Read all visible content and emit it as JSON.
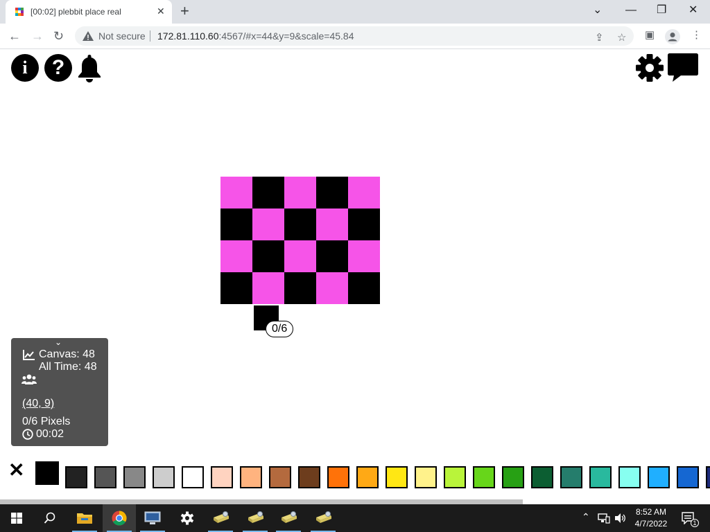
{
  "browser": {
    "tab_title": "[00:02] plebbit place real",
    "tab_close": "✕",
    "new_tab": "+",
    "window_controls": {
      "minimize": "—",
      "maximize": "❐",
      "close": "✕"
    },
    "nav": {
      "back": "←",
      "forward": "→",
      "reload": "↻"
    },
    "security_label": "Not secure",
    "url_host": "172.81.110.60",
    "url_rest": ":4567/#x=44&y=9&scale=45.84",
    "icons": [
      "share-icon",
      "star-icon",
      "sidebar-icon",
      "profile-icon",
      "menu-icon"
    ]
  },
  "page": {
    "top_left_icons": [
      "info-icon",
      "help-icon",
      "bell-icon"
    ],
    "top_right_icons": [
      "gear-icon",
      "chat-icon"
    ],
    "info_glyph": "i",
    "help_glyph": "?",
    "board": {
      "rows": [
        [
          "#f654e8",
          "#000000",
          "#f654e8",
          "#000000",
          "#f654e8"
        ],
        [
          "#000000",
          "#f654e8",
          "#000000",
          "#f654e8",
          "#000000"
        ],
        [
          "#f654e8",
          "#000000",
          "#f654e8",
          "#000000",
          "#f654e8"
        ],
        [
          "#000000",
          "#f654e8",
          "#000000",
          "#f654e8",
          "#000000"
        ]
      ]
    },
    "cursor_badge": "0/6",
    "stats": {
      "chevron": "⌄",
      "canvas_label": "Canvas: 48",
      "alltime_label": "All Time: 48",
      "coords": "(40, 9)",
      "pixels": "0/6 Pixels",
      "timer": "00:02"
    },
    "close_label": "✕",
    "palette": [
      "#000000",
      "#222222",
      "#555555",
      "#888888",
      "#cdcdcd",
      "#ffffff",
      "#ffd3c0",
      "#ffb37f",
      "#b46a3e",
      "#6d3d1d",
      "#ff7209",
      "#ffa915",
      "#ffe714",
      "#fff28b",
      "#b9f43a",
      "#67d61a",
      "#27a014",
      "#0c5e32",
      "#257d6c",
      "#29b99e",
      "#87fff0",
      "#20afff",
      "#1567d2",
      "#1d2b7a"
    ],
    "selected_color": "#000000"
  },
  "taskbar": {
    "apps": [
      "windows-start-icon",
      "search-icon",
      "file-explorer-icon",
      "chrome-icon",
      "network-monitor-icon",
      "settings-icon",
      "app-icon-1",
      "app-icon-2",
      "app-icon-3",
      "app-icon-4"
    ],
    "time": "8:52 AM",
    "date": "4/7/2022",
    "notification_count": "1"
  }
}
